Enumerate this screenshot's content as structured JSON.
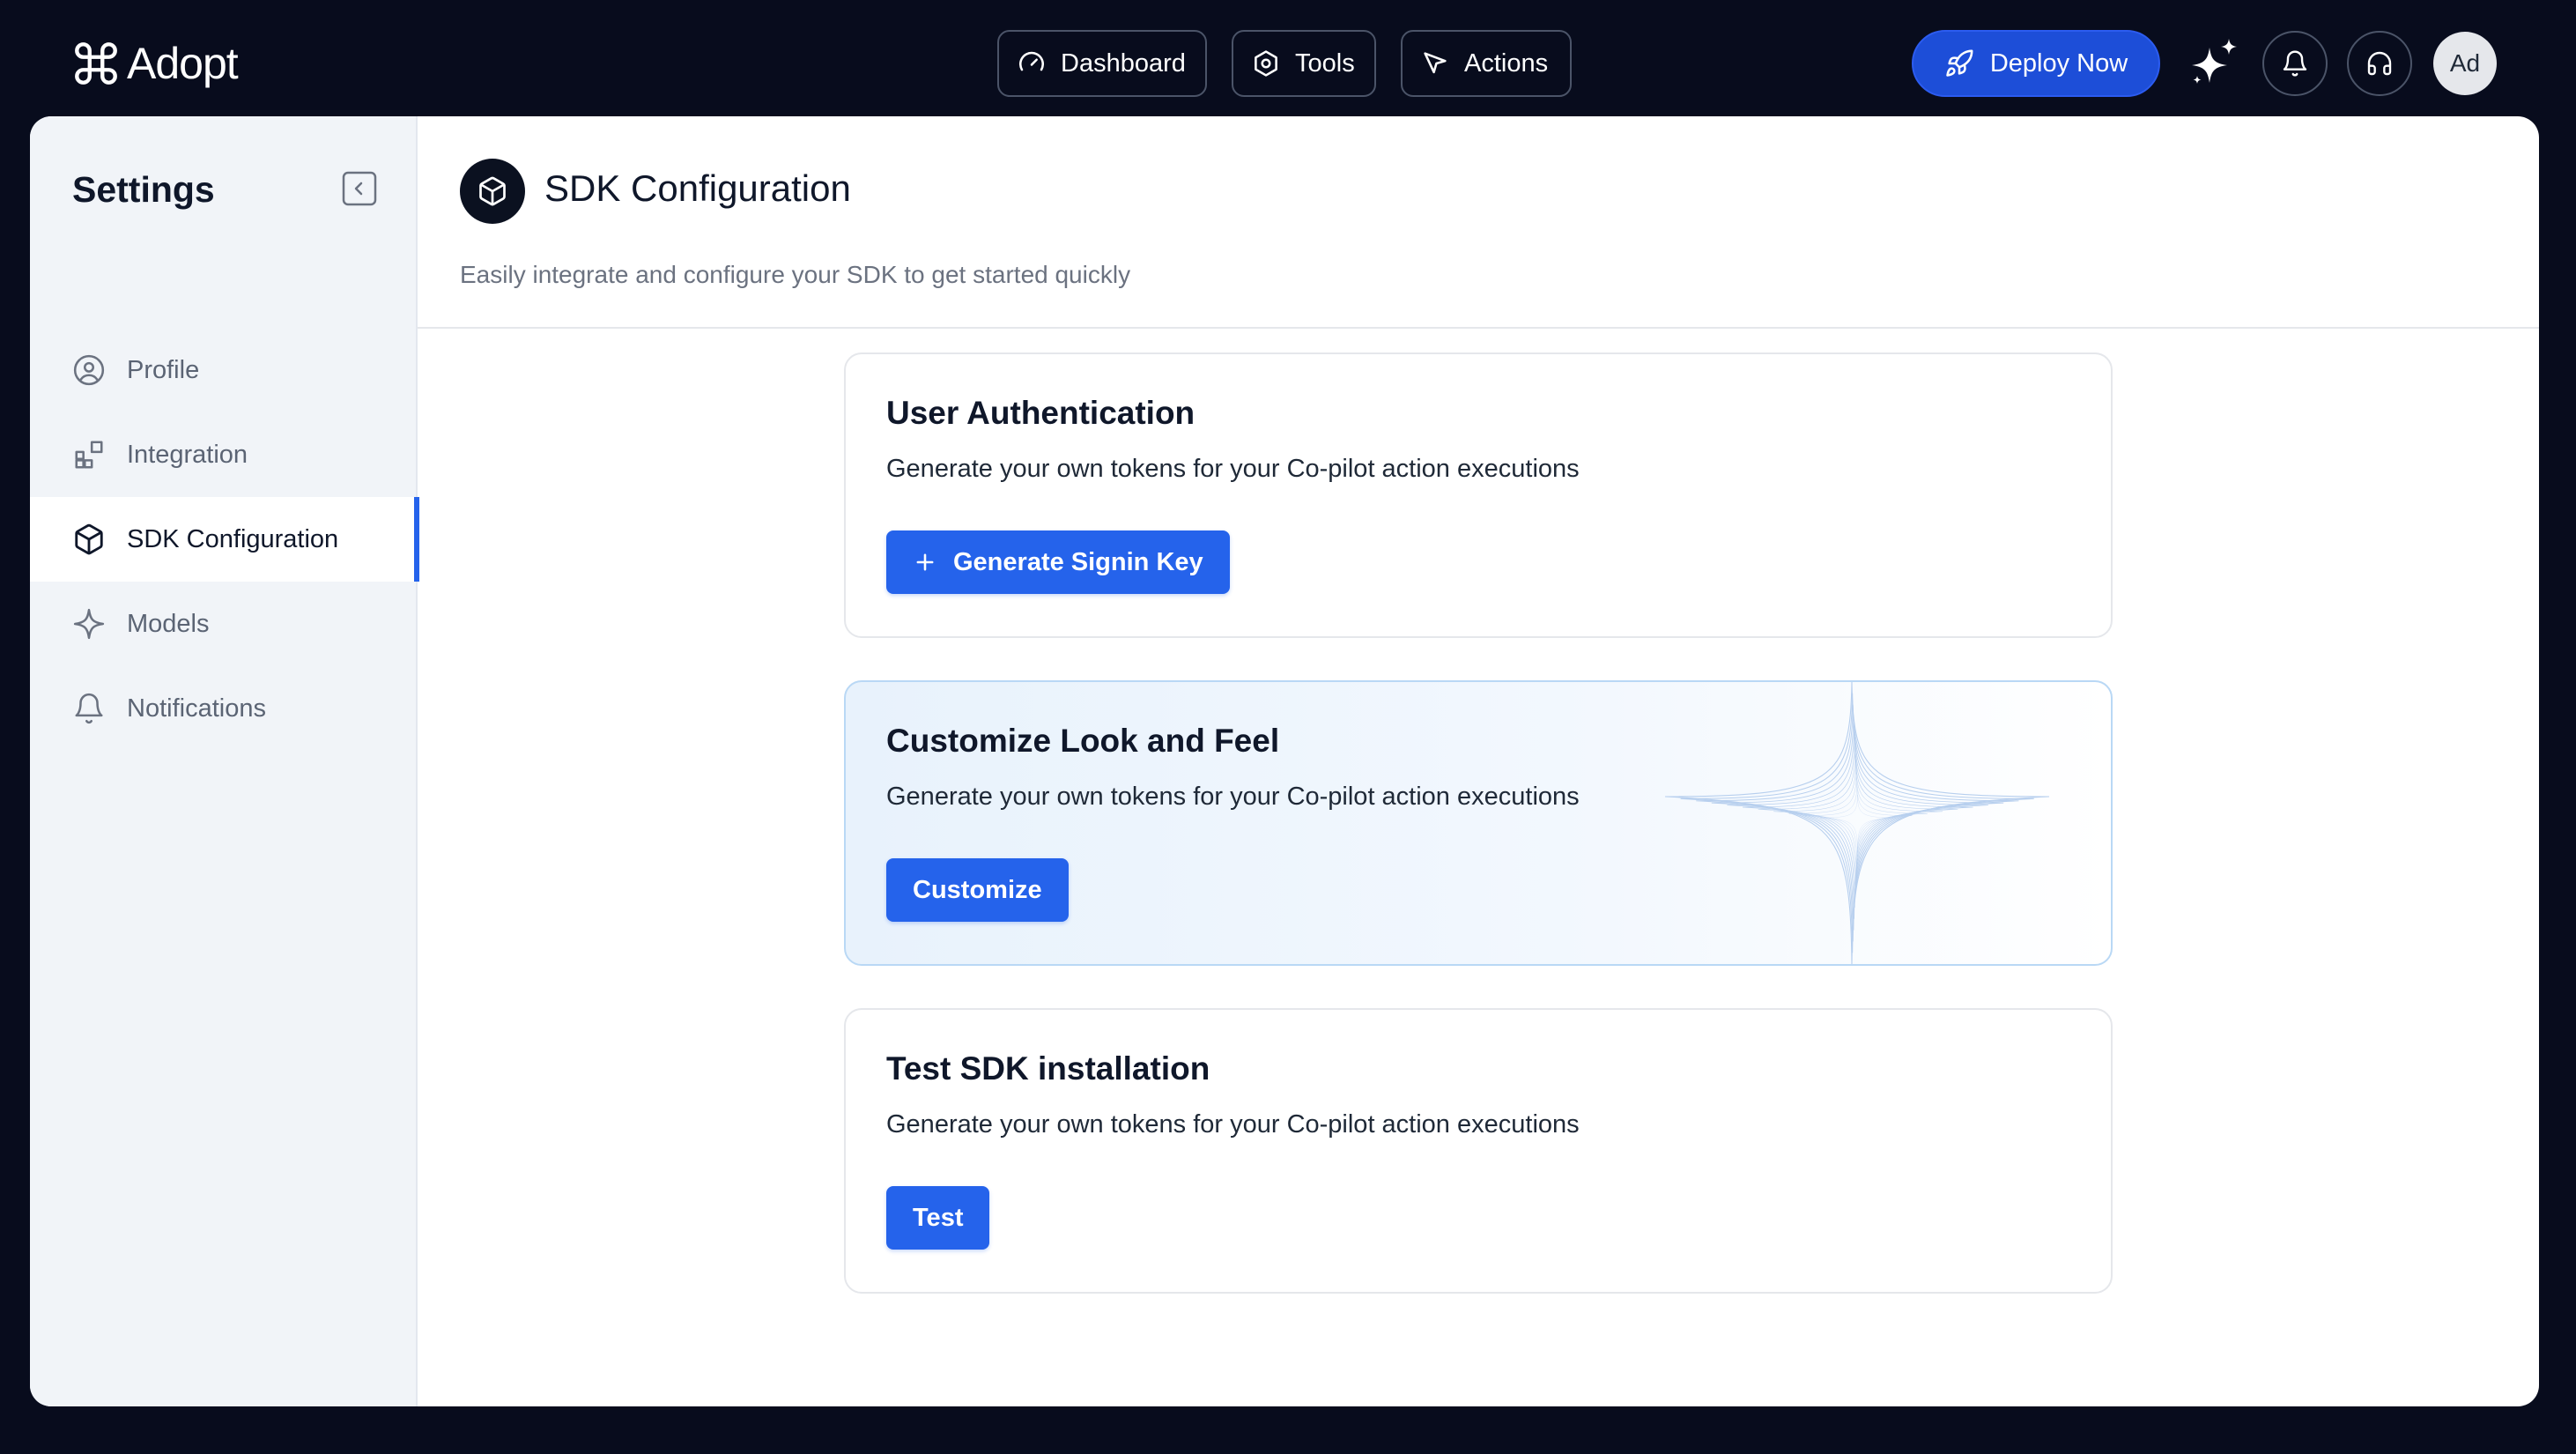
{
  "app": {
    "name": "Adopt"
  },
  "topnav": {
    "items": [
      {
        "label": "Dashboard",
        "icon": "gauge-icon"
      },
      {
        "label": "Tools",
        "icon": "hexagon-gear-icon"
      },
      {
        "label": "Actions",
        "icon": "cursor-arrow-icon"
      }
    ],
    "deploy_label": "Deploy Now",
    "avatar_initials": "Ad"
  },
  "sidebar": {
    "title": "Settings",
    "items": [
      {
        "label": "Profile",
        "icon": "user-circle-icon",
        "active": false
      },
      {
        "label": "Integration",
        "icon": "blocks-icon",
        "active": false
      },
      {
        "label": "SDK Configuration",
        "icon": "cube-icon",
        "active": true
      },
      {
        "label": "Models",
        "icon": "sparkle-icon",
        "active": false
      },
      {
        "label": "Notifications",
        "icon": "bell-icon",
        "active": false
      }
    ]
  },
  "page": {
    "title": "SDK Configuration",
    "subtitle": "Easily integrate and configure your SDK to get started quickly"
  },
  "cards": [
    {
      "title": "User Authentication",
      "description": "Generate your own tokens for your Co-pilot action executions",
      "button": "Generate Signin Key"
    },
    {
      "title": "Customize Look and Feel",
      "description": "Generate your own tokens for your Co-pilot action executions",
      "button": "Customize"
    },
    {
      "title": "Test SDK installation",
      "description": "Generate your own tokens for your Co-pilot action executions",
      "button": "Test"
    }
  ],
  "colors": {
    "topbar_bg": "#080c1d",
    "accent": "#2563eb",
    "deploy_bg": "#1d4ed8",
    "sidebar_bg": "#f1f4f8"
  }
}
